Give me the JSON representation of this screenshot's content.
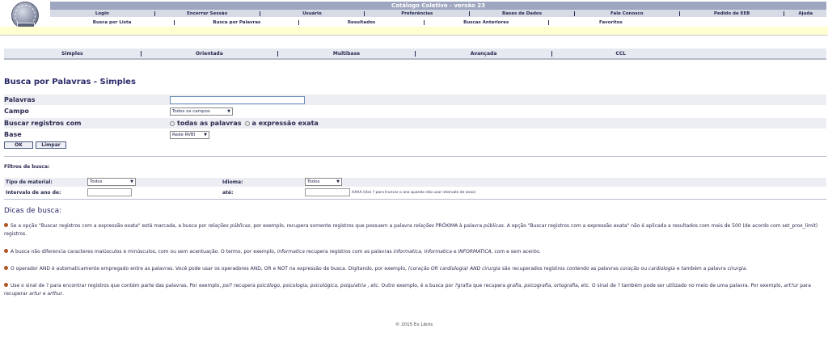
{
  "header": {
    "title": "Catálogo Coletivo - versão 23",
    "menu": [
      "Login",
      "Encerrar Sessão",
      "Usuário",
      "Preferências",
      "Bases de Dados",
      "Fale Conosco",
      "Pedido de EEB",
      "Ajuda"
    ],
    "submenu": [
      "Busca por Lista",
      "Busca por Palavras",
      "Resultados",
      "Buscas Anteriores",
      "Favoritos"
    ]
  },
  "search_tabs": [
    "Simples",
    "Orientada",
    "Multibase",
    "Avançada",
    "CCL"
  ],
  "form": {
    "title": "Busca por Palavras - Simples",
    "palavras_label": "Palavras",
    "palavras_value": "",
    "campo_label": "Campo",
    "campo_value": "Todos os campos",
    "buscar_label": "Buscar registros com",
    "radio_todas": "todas as palavras",
    "radio_exata": "a expressão exata",
    "base_label": "Base",
    "base_value": "Rede RVBI",
    "ok": "OK",
    "limpar": "Limpar"
  },
  "filters": {
    "title": "Filtros de busca:",
    "tipo_label": "Tipo de material:",
    "tipo_value": "Todos",
    "idioma_label": "Idioma:",
    "idioma_value": "Todos",
    "intervalo_label": "Intervalo de ano de:",
    "intervalo_value": "",
    "ate_label": "até:",
    "ate_value": "",
    "hint": "AAAA (Use ? para truncar o ano quando não usar intervalo de anos)"
  },
  "tips": {
    "title": "Dicas de busca:",
    "tip1": {
      "a": "Se a opção \"Buscar registros com a expressão exata\" está marcada, a busca por ",
      "b": "relações públicas",
      "c": ", por exemplo, recupera somente registros que possuem a palavra ",
      "d": "relações",
      "e": " PRÓXIMA à palavra ",
      "f": "públicas",
      "g": ". A opção \"Buscar registros com a expressão exata\" não é aplicada a resultados com mais de 500 (de acordo com set_prox_limit) registros."
    },
    "tip2": {
      "a": "A busca não diferencia caracteres maiúsculos e minúsculos, com ou sem acentuação. O termo, por exemplo, ",
      "b": "informatica",
      "c": " recupera registros com as palavras ",
      "d": "informatica, Informatica",
      "e": " e ",
      "f": "INFORMATICA",
      "g": ", com e sem acento."
    },
    "tip3": {
      "a": "O operador AND é automaticamente empregado entre as palavras. Você pode usar os operadores AND, OR e NOT na expressão de busca. Digitando, por exemplo, ",
      "b": "(coração OR cardiologia) AND cirurgia",
      "c": " são recuperados registros contendo as palavras ",
      "d": "coração",
      "e": " ou ",
      "f": "cardiologia",
      "g": " e também a palavra ",
      "h": "cirurgia",
      "i": "."
    },
    "tip4": {
      "a": "Use o sinal de ? para encontrar registros que contém parte das palavras. Por exemplo, ",
      "b": "psi?",
      "c": " recupera ",
      "d": "psicólogo, psicologia, psicológico, psiquiatria , etc.",
      "e": " Outro exemplo, é a busca por ",
      "f": "?grafia",
      "g": " que recupera ",
      "h": "grafia, psicografia, ortografia, etc.",
      "i": " O sinal de ? também pode ser utilizado no meio de uma palavra. Por exemplo, ",
      "j": "art?ur",
      "k": " para recuperar ",
      "l": "artur",
      "m": " e ",
      "n": "arthur",
      "o": "."
    }
  },
  "footer": "© 2015 Ex Libris"
}
